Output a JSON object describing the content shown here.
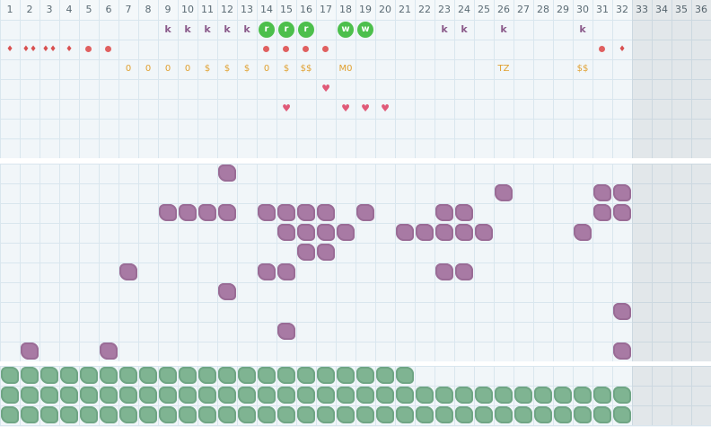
{
  "columns": [
    "1",
    "2",
    "3",
    "4",
    "5",
    "6",
    "7",
    "8",
    "9",
    "10",
    "11",
    "12",
    "13",
    "14",
    "15",
    "16",
    "17",
    "18",
    "19",
    "20",
    "21",
    "22",
    "23",
    "24",
    "25",
    "26",
    "27",
    "28",
    "29",
    "30",
    "31",
    "32",
    "33",
    "34",
    "35",
    "36"
  ],
  "colors": {
    "purple_tile": "#a87aa4",
    "green_tile": "#7fb492",
    "badge_green": "#4cbf4c",
    "marker_text": "#e0a030",
    "red_marker": "#e06060",
    "heart": "#e05a78",
    "k_letter": "#8a5a8a"
  },
  "bands": {
    "top_rows": 7,
    "middle_rows": 10,
    "bottom_rows": 3
  },
  "shaded_columns": [
    33,
    34,
    35,
    36
  ],
  "row_k": [
    {
      "col": 9,
      "text": "k"
    },
    {
      "col": 10,
      "text": "k"
    },
    {
      "col": 11,
      "text": "k"
    },
    {
      "col": 12,
      "text": "k"
    },
    {
      "col": 13,
      "text": "k"
    },
    {
      "col": 23,
      "text": "k"
    },
    {
      "col": 24,
      "text": "k"
    },
    {
      "col": 26,
      "text": "k"
    },
    {
      "col": 30,
      "text": "k"
    }
  ],
  "badges": [
    {
      "col": 14,
      "text": "r"
    },
    {
      "col": 15,
      "text": "r"
    },
    {
      "col": 16,
      "text": "r"
    },
    {
      "col": 18,
      "text": "w"
    },
    {
      "col": 19,
      "text": "w"
    }
  ],
  "row_red": [
    {
      "col": 1,
      "kind": "drop",
      "glyph": "♦"
    },
    {
      "col": 2,
      "kind": "drop",
      "glyph": "♦♦"
    },
    {
      "col": 3,
      "kind": "drop",
      "glyph": "♦♦"
    },
    {
      "col": 4,
      "kind": "drop",
      "glyph": "♦"
    },
    {
      "col": 5,
      "kind": "dot"
    },
    {
      "col": 6,
      "kind": "dot"
    },
    {
      "col": 14,
      "kind": "dot"
    },
    {
      "col": 15,
      "kind": "dot"
    },
    {
      "col": 16,
      "kind": "dot"
    },
    {
      "col": 17,
      "kind": "dot"
    },
    {
      "col": 31,
      "kind": "dot"
    },
    {
      "col": 32,
      "kind": "drop",
      "glyph": "♦"
    }
  ],
  "row_text": [
    {
      "col": 7,
      "text": "0"
    },
    {
      "col": 8,
      "text": "0"
    },
    {
      "col": 9,
      "text": "0"
    },
    {
      "col": 10,
      "text": "0"
    },
    {
      "col": 11,
      "text": "$"
    },
    {
      "col": 12,
      "text": "$"
    },
    {
      "col": 13,
      "text": "$"
    },
    {
      "col": 14,
      "text": "0"
    },
    {
      "col": 15,
      "text": "$"
    },
    {
      "col": 16,
      "text": "$$"
    },
    {
      "col": 18,
      "text": "M0"
    },
    {
      "col": 26,
      "text": "TZ"
    },
    {
      "col": 30,
      "text": "$$"
    }
  ],
  "hearts": [
    {
      "col": 15,
      "row": 5,
      "glyph": "♥"
    },
    {
      "col": 17,
      "row": 4,
      "glyph": "♥"
    },
    {
      "col": 18,
      "row": 5,
      "glyph": "♥"
    },
    {
      "col": 19,
      "row": 5,
      "glyph": "♥"
    },
    {
      "col": 20,
      "row": 5,
      "glyph": "♥"
    }
  ],
  "purple_tiles": [
    [
      12,
      1
    ],
    [
      26,
      2
    ],
    [
      31,
      2
    ],
    [
      32,
      2
    ],
    [
      9,
      3
    ],
    [
      10,
      3
    ],
    [
      11,
      3
    ],
    [
      12,
      3
    ],
    [
      14,
      3
    ],
    [
      15,
      3
    ],
    [
      16,
      3
    ],
    [
      17,
      3
    ],
    [
      19,
      3
    ],
    [
      23,
      3
    ],
    [
      24,
      3
    ],
    [
      31,
      3
    ],
    [
      32,
      3
    ],
    [
      15,
      4
    ],
    [
      16,
      4
    ],
    [
      17,
      4
    ],
    [
      18,
      4
    ],
    [
      21,
      4
    ],
    [
      22,
      4
    ],
    [
      23,
      4
    ],
    [
      24,
      4
    ],
    [
      25,
      4
    ],
    [
      30,
      4
    ],
    [
      16,
      5
    ],
    [
      17,
      5
    ],
    [
      7,
      6
    ],
    [
      14,
      6
    ],
    [
      15,
      6
    ],
    [
      23,
      6
    ],
    [
      24,
      6
    ],
    [
      12,
      7
    ],
    [
      32,
      8
    ],
    [
      15,
      9
    ],
    [
      2,
      10
    ],
    [
      6,
      10
    ],
    [
      32,
      10
    ]
  ],
  "green_tiles": {
    "row1_count": 21,
    "row2_count": 32,
    "row3_count": 32
  }
}
